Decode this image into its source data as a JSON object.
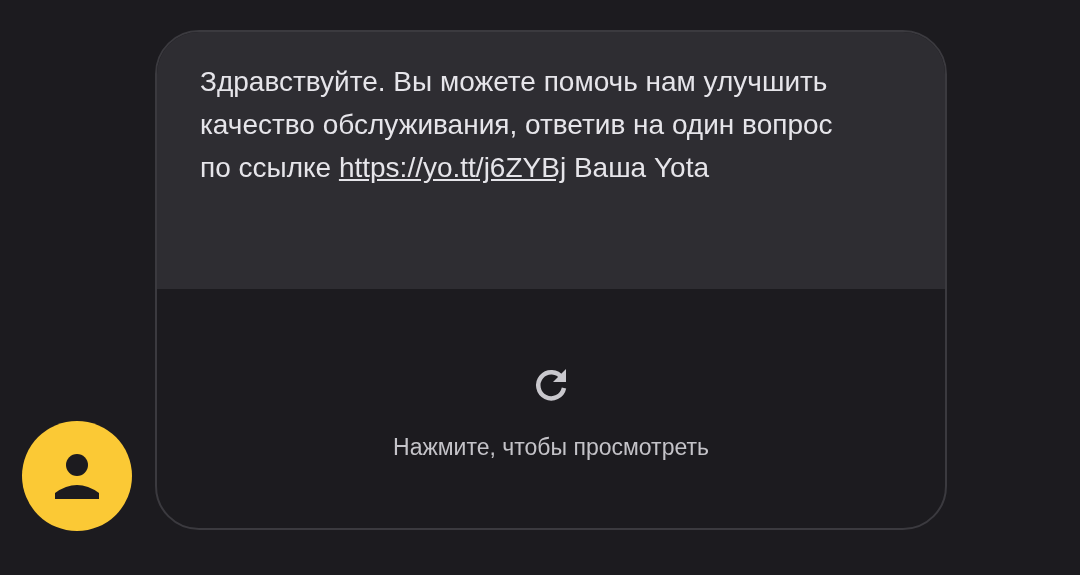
{
  "message": {
    "text": "Здравствуйте. Вы можете помочь нам улучшить качество обслуживания, ответив на один вопрос по ссылке",
    "link": "https://yo.tt/j6ZYBj",
    "signature": "Ваша Yota"
  },
  "preview": {
    "label": "Нажмите, чтобы просмотреть"
  }
}
